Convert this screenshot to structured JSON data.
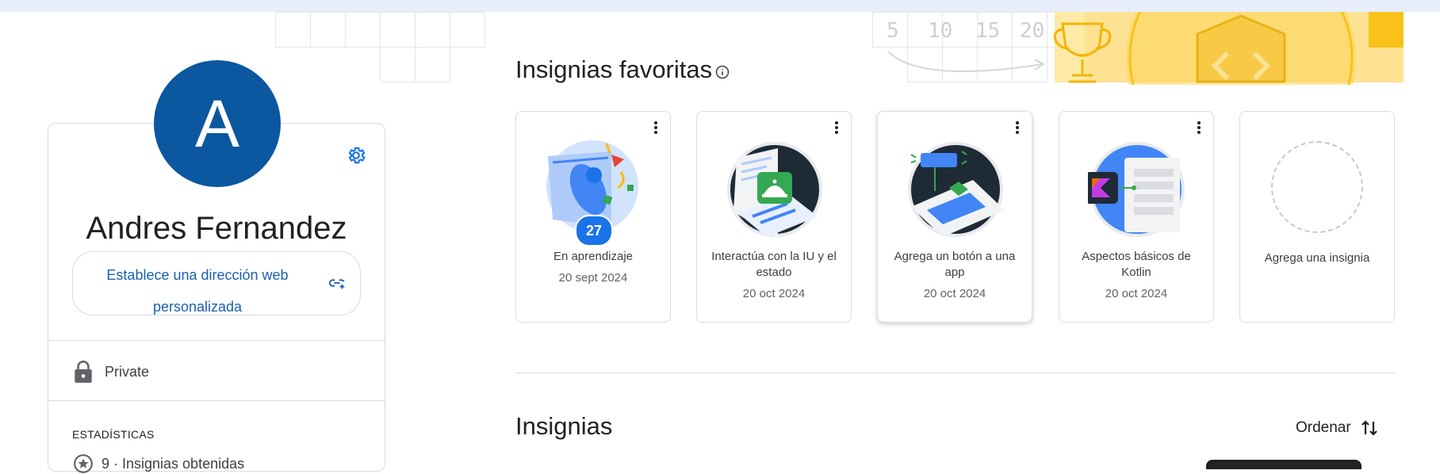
{
  "profile": {
    "avatar_letter": "A",
    "name": "Andres Fernandez",
    "custom_url_label": "Establece una dirección web personalizada",
    "privacy_label": "Private",
    "stats_heading": "ESTADÍSTICAS",
    "stats_partial": "9 · Insignias obtenidas"
  },
  "favorites": {
    "title": "Insignias favoritas",
    "badges": [
      {
        "title": "En aprendizaje",
        "date": "20 sept 2024",
        "count": "27"
      },
      {
        "title": "Interactúa con la IU y el estado",
        "date": "20 oct 2024"
      },
      {
        "title": "Agrega un botón a una app",
        "date": "20 oct 2024"
      },
      {
        "title": "Aspectos básicos de Kotlin",
        "date": "20 oct 2024"
      },
      {
        "title": "Agrega una insignia"
      }
    ]
  },
  "badges_section": {
    "title": "Insignias",
    "sort_label": "Ordenar"
  },
  "banner": {
    "numbers": [
      "5",
      "10",
      "15",
      "20"
    ]
  },
  "colors": {
    "accent": "#1a73e8",
    "avatar": "#0b57a0",
    "banner_yellow": "#fde293",
    "banner_gold": "#fbbc04"
  }
}
